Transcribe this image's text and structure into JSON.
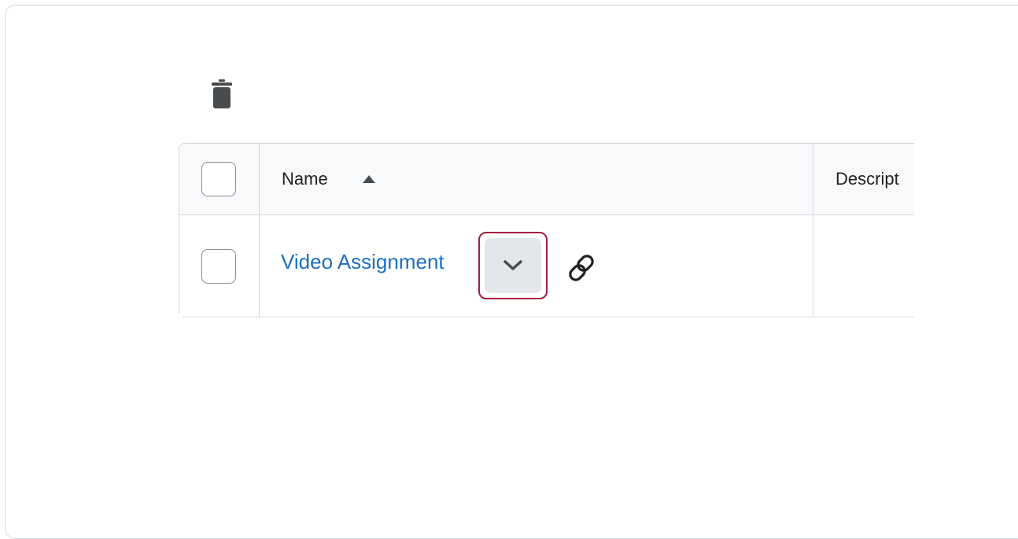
{
  "toolbar": {
    "delete_icon": "trash-icon"
  },
  "table": {
    "columns": [
      {
        "label": "Name",
        "sort": "ascending"
      },
      {
        "label": "Descript"
      }
    ],
    "rows": [
      {
        "name": "Video Assignment",
        "actions": [
          "chevron-down-icon",
          "link-icon"
        ]
      }
    ]
  },
  "colors": {
    "link": "#1c6fbd",
    "highlight": "#a51c3c",
    "button_bg": "#e3e6ea",
    "border": "#d4d7dc"
  }
}
